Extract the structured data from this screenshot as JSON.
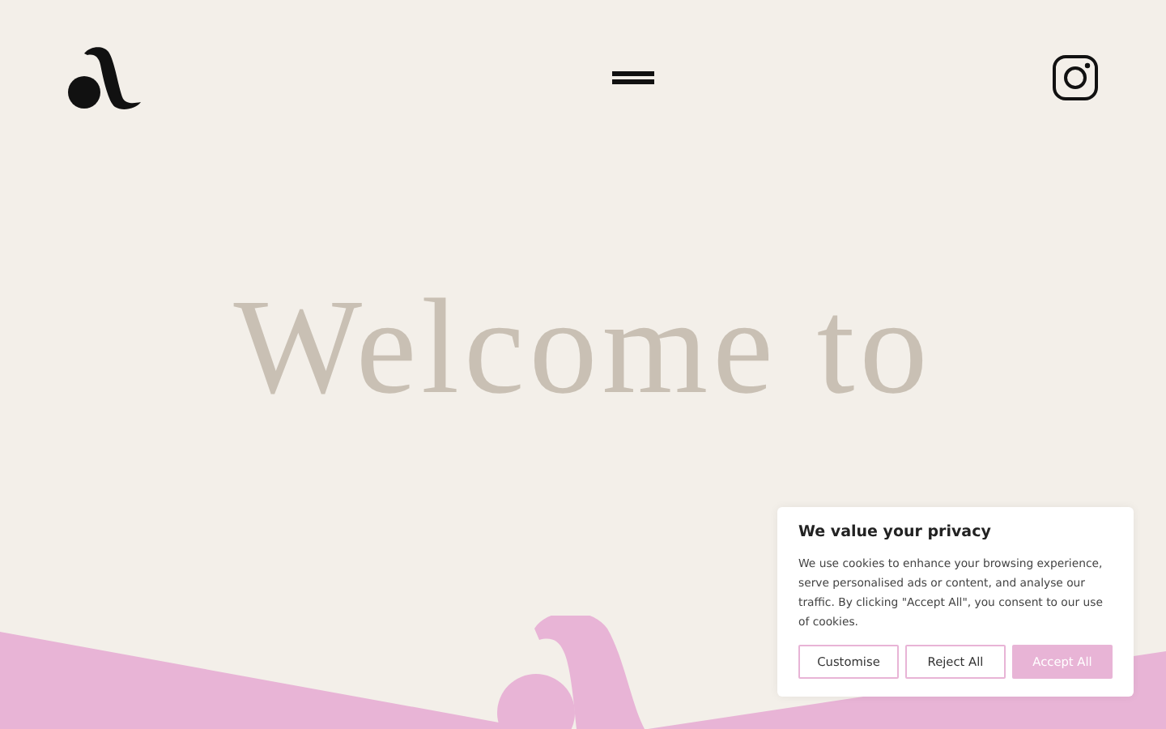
{
  "hero": {
    "heading": "Welcome to"
  },
  "cookie_banner": {
    "title": "We value your privacy",
    "text": "We use cookies to enhance your browsing experience, serve personalised ads or content, and analyse our traffic. By clicking \"Accept All\", you consent to our use of cookies.",
    "buttons": [
      {
        "label": "Customise",
        "kind": "outline"
      },
      {
        "label": "Reject All",
        "kind": "outline"
      },
      {
        "label": "Accept All",
        "kind": "filled"
      }
    ]
  }
}
